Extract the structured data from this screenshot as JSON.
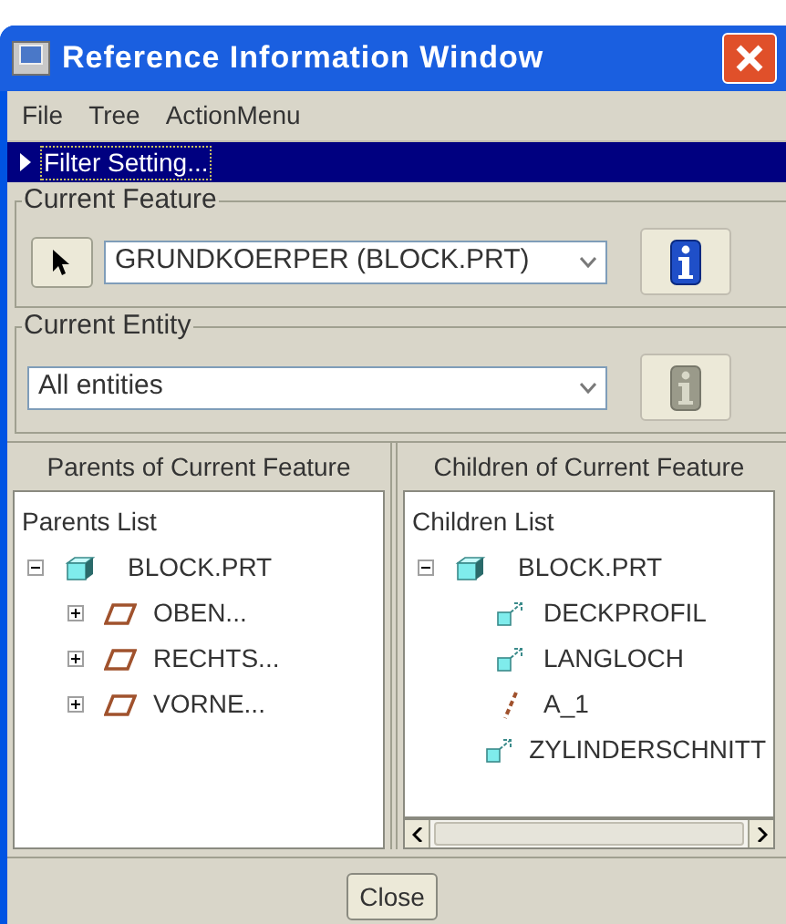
{
  "window": {
    "title": "Reference Information Window"
  },
  "menu": [
    "File",
    "Tree",
    "ActionMenu"
  ],
  "filter": {
    "label": "Filter Setting...",
    "expanded": false
  },
  "current_feature": {
    "legend": "Current Feature",
    "value": "GRUNDKOERPER (BLOCK.PRT)",
    "info_disabled": false
  },
  "current_entity": {
    "legend": "Current Entity",
    "value": "All entities",
    "info_disabled": true
  },
  "parents": {
    "header": "Parents of Current Feature",
    "list_title": "Parents List",
    "tree": [
      {
        "label": "BLOCK.PRT",
        "kind": "part",
        "expanded": true,
        "children": [
          {
            "label": "OBEN...",
            "kind": "plane",
            "expanded": false
          },
          {
            "label": "RECHTS...",
            "kind": "plane",
            "expanded": false
          },
          {
            "label": "VORNE...",
            "kind": "plane",
            "expanded": false
          }
        ]
      }
    ]
  },
  "children_panel": {
    "header": "Children of Current Feature",
    "list_title": "Children List",
    "tree": [
      {
        "label": "BLOCK.PRT",
        "kind": "part",
        "expanded": true,
        "children": [
          {
            "label": "DECKPROFIL",
            "kind": "feature"
          },
          {
            "label": "LANGLOCH",
            "kind": "feature"
          },
          {
            "label": "A_1",
            "kind": "axis"
          },
          {
            "label": "ZYLINDERSCHNITT",
            "kind": "feature"
          }
        ]
      }
    ]
  },
  "buttons": [
    "Close"
  ]
}
